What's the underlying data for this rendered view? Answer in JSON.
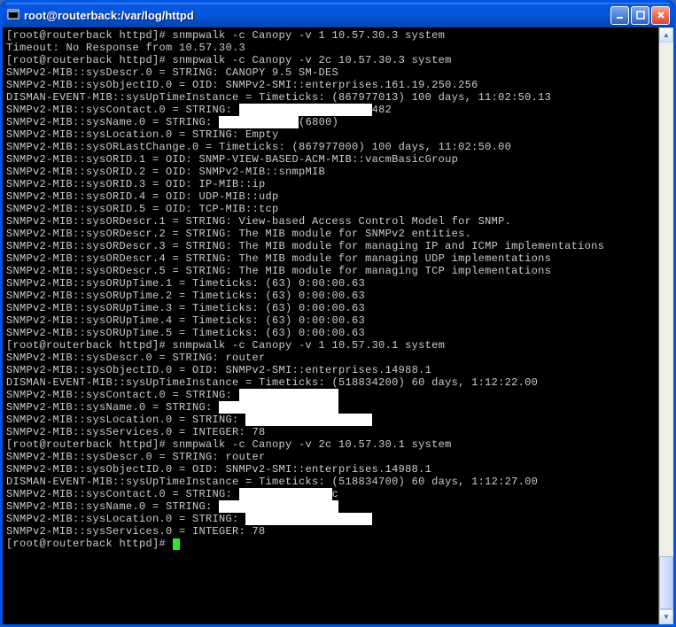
{
  "window": {
    "title": "root@routerback:/var/log/httpd"
  },
  "prompt": "[root@routerback httpd]# ",
  "lines": [
    {
      "t": "prompt",
      "cmd": "snmpwalk -c Canopy -v 1 10.57.30.3 system"
    },
    {
      "t": "out",
      "txt": "Timeout: No Response from 10.57.30.3"
    },
    {
      "t": "prompt",
      "cmd": "snmpwalk -c Canopy -v 2c 10.57.30.3 system"
    },
    {
      "t": "out",
      "txt": "SNMPv2-MIB::sysDescr.0 = STRING: CANOPY 9.5 SM-DES"
    },
    {
      "t": "out",
      "txt": "SNMPv2-MIB::sysObjectID.0 = OID: SNMPv2-SMI::enterprises.161.19.250.256"
    },
    {
      "t": "out",
      "txt": "DISMAN-EVENT-MIB::sysUpTimeInstance = Timeticks: (867977013) 100 days, 11:02:50.13"
    },
    {
      "t": "redact",
      "pre": "SNMPv2-MIB::sysContact.0 = STRING: ",
      "mask": "                    ",
      "post": "482"
    },
    {
      "t": "redact",
      "pre": "SNMPv2-MIB::sysName.0 = STRING: ",
      "mask": "            ",
      "post": "(6800)"
    },
    {
      "t": "out",
      "txt": "SNMPv2-MIB::sysLocation.0 = STRING: Empty"
    },
    {
      "t": "out",
      "txt": "SNMPv2-MIB::sysORLastChange.0 = Timeticks: (867977000) 100 days, 11:02:50.00"
    },
    {
      "t": "out",
      "txt": "SNMPv2-MIB::sysORID.1 = OID: SNMP-VIEW-BASED-ACM-MIB::vacmBasicGroup"
    },
    {
      "t": "out",
      "txt": "SNMPv2-MIB::sysORID.2 = OID: SNMPv2-MIB::snmpMIB"
    },
    {
      "t": "out",
      "txt": "SNMPv2-MIB::sysORID.3 = OID: IP-MIB::ip"
    },
    {
      "t": "out",
      "txt": "SNMPv2-MIB::sysORID.4 = OID: UDP-MIB::udp"
    },
    {
      "t": "out",
      "txt": "SNMPv2-MIB::sysORID.5 = OID: TCP-MIB::tcp"
    },
    {
      "t": "out",
      "txt": "SNMPv2-MIB::sysORDescr.1 = STRING: View-based Access Control Model for SNMP."
    },
    {
      "t": "out",
      "txt": "SNMPv2-MIB::sysORDescr.2 = STRING: The MIB module for SNMPv2 entities."
    },
    {
      "t": "out",
      "txt": "SNMPv2-MIB::sysORDescr.3 = STRING: The MIB module for managing IP and ICMP implementations"
    },
    {
      "t": "out",
      "txt": "SNMPv2-MIB::sysORDescr.4 = STRING: The MIB module for managing UDP implementations"
    },
    {
      "t": "out",
      "txt": "SNMPv2-MIB::sysORDescr.5 = STRING: The MIB module for managing TCP implementations"
    },
    {
      "t": "out",
      "txt": "SNMPv2-MIB::sysORUpTime.1 = Timeticks: (63) 0:00:00.63"
    },
    {
      "t": "out",
      "txt": "SNMPv2-MIB::sysORUpTime.2 = Timeticks: (63) 0:00:00.63"
    },
    {
      "t": "out",
      "txt": "SNMPv2-MIB::sysORUpTime.3 = Timeticks: (63) 0:00:00.63"
    },
    {
      "t": "out",
      "txt": "SNMPv2-MIB::sysORUpTime.4 = Timeticks: (63) 0:00:00.63"
    },
    {
      "t": "out",
      "txt": "SNMPv2-MIB::sysORUpTime.5 = Timeticks: (63) 0:00:00.63"
    },
    {
      "t": "prompt",
      "cmd": "snmpwalk -c Canopy -v 1 10.57.30.1 system"
    },
    {
      "t": "out",
      "txt": "SNMPv2-MIB::sysDescr.0 = STRING: router"
    },
    {
      "t": "out",
      "txt": "SNMPv2-MIB::sysObjectID.0 = OID: SNMPv2-SMI::enterprises.14988.1"
    },
    {
      "t": "out",
      "txt": "DISMAN-EVENT-MIB::sysUpTimeInstance = Timeticks: (518834200) 60 days, 1:12:22.00"
    },
    {
      "t": "redact",
      "pre": "SNMPv2-MIB::sysContact.0 = STRING: ",
      "mask": "               ",
      "post": ""
    },
    {
      "t": "redact",
      "pre": "SNMPv2-MIB::sysName.0 = STRING: ",
      "mask": "                  ",
      "post": ""
    },
    {
      "t": "redact",
      "pre": "SNMPv2-MIB::sysLocation.0 = STRING: ",
      "mask": "                   ",
      "post": ""
    },
    {
      "t": "out",
      "txt": "SNMPv2-MIB::sysServices.0 = INTEGER: 78"
    },
    {
      "t": "prompt",
      "cmd": "snmpwalk -c Canopy -v 2c 10.57.30.1 system"
    },
    {
      "t": "out",
      "txt": "SNMPv2-MIB::sysDescr.0 = STRING: router"
    },
    {
      "t": "out",
      "txt": "SNMPv2-MIB::sysObjectID.0 = OID: SNMPv2-SMI::enterprises.14988.1"
    },
    {
      "t": "out",
      "txt": "DISMAN-EVENT-MIB::sysUpTimeInstance = Timeticks: (518834700) 60 days, 1:12:27.00"
    },
    {
      "t": "redact",
      "pre": "SNMPv2-MIB::sysContact.0 = STRING: ",
      "mask": "              ",
      "post": "c"
    },
    {
      "t": "redact",
      "pre": "SNMPv2-MIB::sysName.0 = STRING: ",
      "mask": "                  ",
      "post": ""
    },
    {
      "t": "redact",
      "pre": "SNMPv2-MIB::sysLocation.0 = STRING: ",
      "mask": "                   ",
      "post": ""
    },
    {
      "t": "out",
      "txt": "SNMPv2-MIB::sysServices.0 = INTEGER: 78"
    },
    {
      "t": "prompt",
      "cmd": "",
      "cursor": true
    }
  ]
}
